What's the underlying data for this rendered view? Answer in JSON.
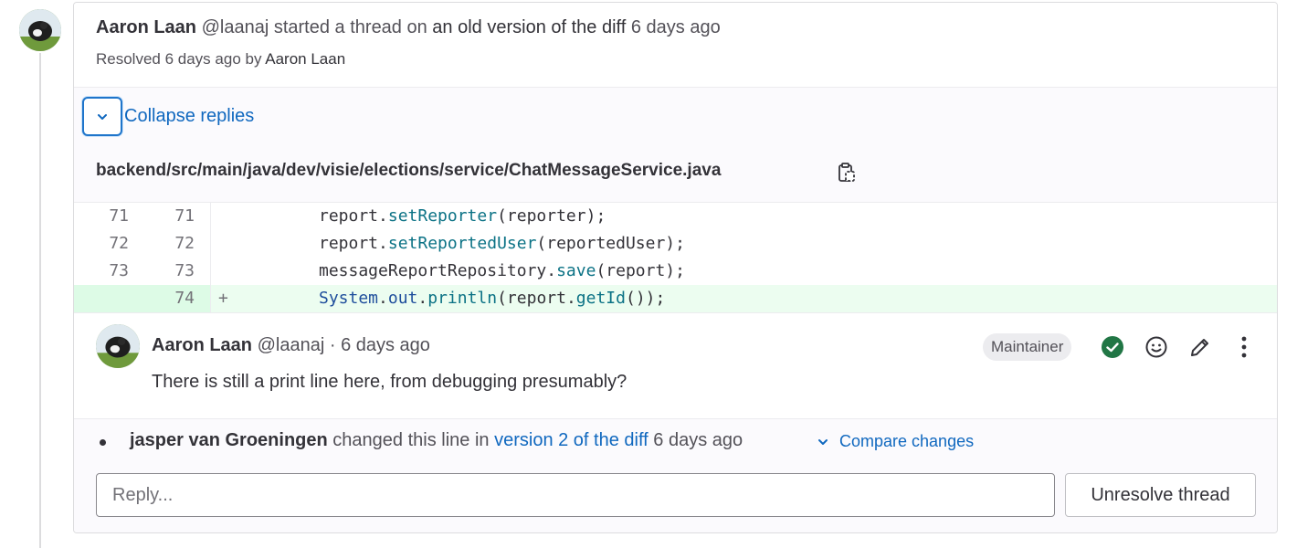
{
  "thread": {
    "author_name": "Aaron Laan",
    "author_handle": "@laanaj",
    "started_text": "started a thread on",
    "diff_link": "an old version of the diff",
    "time_ago": "6 days ago",
    "resolved_prefix": "Resolved 6 days ago by",
    "resolved_by": "Aaron Laan",
    "collapse_label": "Collapse replies",
    "file_path": "backend/src/main/java/dev/visie/elections/service/ChatMessageService.java"
  },
  "icons": {
    "collapse": "chevron-down-icon",
    "copy_path": "clipboard-icon",
    "resolved": "check-circle-icon",
    "emoji": "smiley-icon",
    "edit": "pencil-icon",
    "more": "kebab-icon",
    "compare": "chevron-down-icon"
  },
  "diff": {
    "rows": [
      {
        "old": "71",
        "new": "71",
        "marker": "",
        "pre": "report.",
        "fn": "setReporter",
        "post": "(reporter);"
      },
      {
        "old": "72",
        "new": "72",
        "marker": "",
        "pre": "report.",
        "fn": "setReportedUser",
        "post": "(reportedUser);"
      },
      {
        "old": "73",
        "new": "73",
        "marker": "",
        "pre": "messageReportRepository.",
        "fn": "save",
        "post": "(report);"
      }
    ],
    "added_row": {
      "old": "",
      "new": "74",
      "marker": "+",
      "kw": "System",
      "dot1": ".",
      "field": "out",
      "dot2": ".",
      "fn": "println",
      "mid": "(report.",
      "fn2": "getId",
      "post": "());"
    }
  },
  "note": {
    "author_name": "Aaron Laan",
    "author_handle": "@laanaj",
    "separator": "·",
    "time_ago": "6 days ago",
    "role_badge": "Maintainer",
    "body": "There is still a print line here, from debugging presumably?"
  },
  "system_note": {
    "author": "jasper van Groeningen",
    "action": "changed this line in",
    "link": "version 2 of the diff",
    "time_ago": "6 days ago",
    "compare_label": "Compare changes"
  },
  "reply": {
    "placeholder": "Reply...",
    "unresolve_label": "Unresolve thread"
  },
  "colors": {
    "link": "#1068bf",
    "added_bg": "#ecfdf0",
    "resolved_green": "#217645"
  }
}
